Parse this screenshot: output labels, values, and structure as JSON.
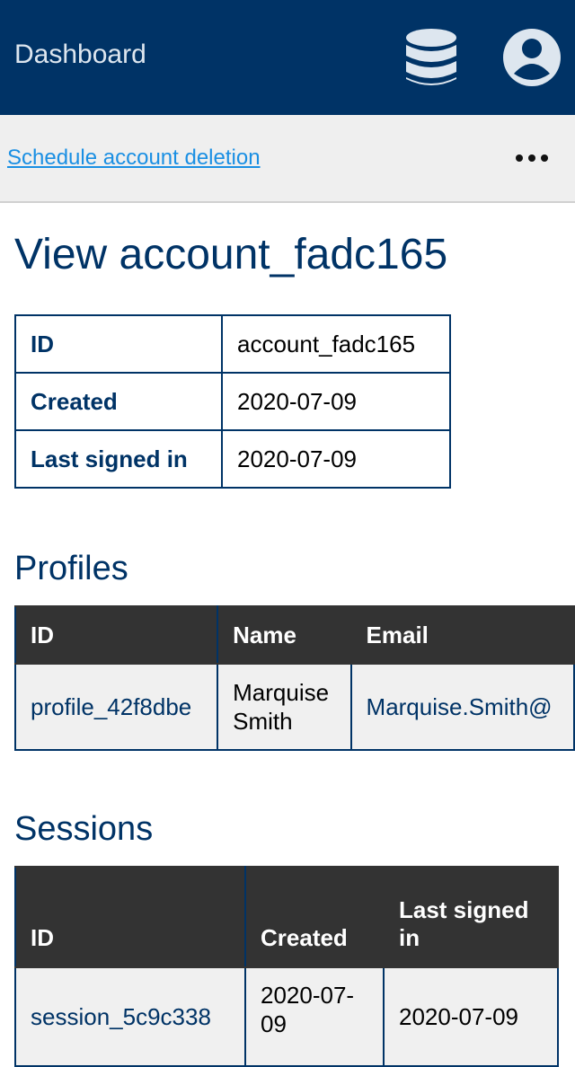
{
  "header": {
    "brand": "Dashboard",
    "icons": [
      "database-icon",
      "user-account-icon"
    ]
  },
  "actions": {
    "schedule_deletion": "Schedule account deletion",
    "more_icon": "more-horizontal-icon"
  },
  "page": {
    "title": "View account_fadc165"
  },
  "account": {
    "rows": [
      {
        "label": "ID",
        "value": "account_fadc165"
      },
      {
        "label": "Created",
        "value": "2020-07-09"
      },
      {
        "label": "Last signed in",
        "value": "2020-07-09"
      }
    ]
  },
  "profiles": {
    "title": "Profiles",
    "headers": [
      "ID",
      "Name",
      "Email"
    ],
    "rows": [
      {
        "id": "profile_42f8dbe",
        "name": "Marquise Smith",
        "email": "Marquise.Smith@"
      }
    ]
  },
  "sessions": {
    "title": "Sessions",
    "headers": [
      "ID",
      "Created",
      "Last signed in"
    ],
    "rows": [
      {
        "id": "session_5c9c338",
        "created": "2020-07-09",
        "last_signed_in": "2020-07-09"
      }
    ]
  },
  "colors": {
    "header_bg": "#003366",
    "action_bar_bg": "#efefef",
    "link": "#1a8fe3",
    "table_header_bg": "#333333",
    "cell_bg": "#f0f0f0"
  }
}
